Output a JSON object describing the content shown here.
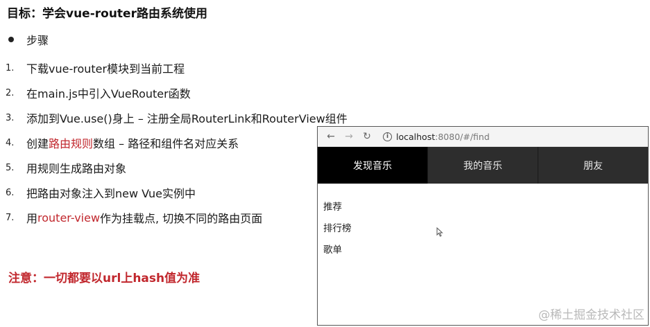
{
  "title": "目标：学会vue-router路由系统使用",
  "bullet": "步骤",
  "steps": [
    {
      "num": "1.",
      "before": "下载vue-router模块到当前工程",
      "highlight": "",
      "after": ""
    },
    {
      "num": "2.",
      "before": "在main.js中引入VueRouter函数",
      "highlight": "",
      "after": ""
    },
    {
      "num": "3.",
      "before": "添加到Vue.use()身上 – 注册全局RouterLink和RouterView组件",
      "highlight": "",
      "after": ""
    },
    {
      "num": "4.",
      "before": "创建",
      "highlight": "路由规则",
      "after": "数组 – 路径和组件名对应关系"
    },
    {
      "num": "5.",
      "before": "用规则生成路由对象",
      "highlight": "",
      "after": ""
    },
    {
      "num": "6.",
      "before": "把路由对象注入到new Vue实例中",
      "highlight": "",
      "after": ""
    },
    {
      "num": "7.",
      "before": "用",
      "highlight": "router-view",
      "after": "作为挂载点, 切换不同的路由页面"
    }
  ],
  "note": "注意：一切都要以url上hash值为准",
  "browser": {
    "back_icon": "←",
    "forward_icon": "→",
    "reload_icon": "↻",
    "info_icon": "i",
    "url_host": "localhost",
    "url_rest": ":8080/#/find",
    "tabs": [
      "发现音乐",
      "我的音乐",
      "朋友"
    ],
    "active_tab_index": 0,
    "sub_items": [
      "推荐",
      "排行榜",
      "歌单"
    ]
  },
  "watermark": "@稀土掘金技术社区",
  "colors": {
    "accent_red": "#c1272d",
    "tab_bg": "#2d2d2d",
    "tab_active_bg": "#000000"
  }
}
